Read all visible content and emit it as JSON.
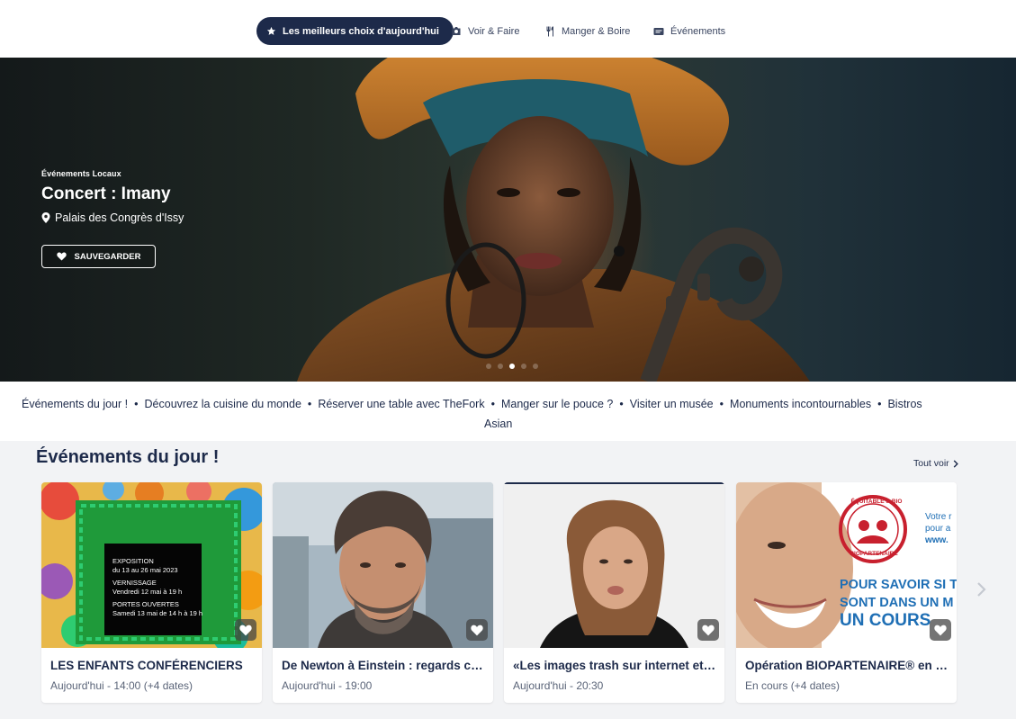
{
  "nav": {
    "tabs": [
      {
        "label": "Les meilleurs choix d'aujourd'hui",
        "icon": "star-icon",
        "active": true
      },
      {
        "label": "Voir & Faire",
        "icon": "camera-icon",
        "active": false
      },
      {
        "label": "Manger & Boire",
        "icon": "cutlery-icon",
        "active": false
      },
      {
        "label": "Événements",
        "icon": "ticket-icon",
        "active": false
      }
    ]
  },
  "hero": {
    "category": "Événements Locaux",
    "title": "Concert : Imany",
    "location": "Palais des Congrès d'Issy",
    "save_label": "SAUVEGARDER",
    "slide_count": 5,
    "active_slide": 2
  },
  "quick_links": {
    "items": [
      "Événements du jour !",
      "Découvrez la cuisine du monde",
      "Réserver une table avec TheFork",
      "Manger sur le pouce ?",
      "Visiter un musée",
      "Monuments incontournables",
      "Bistros"
    ],
    "overflow": "Asian"
  },
  "section": {
    "title": "Événements du jour !",
    "see_all": "Tout voir",
    "cards": [
      {
        "title": "LES ENFANTS CONFÉRENCIERS",
        "date": "Aujourd'hui - 14:00 (+4 dates)",
        "poster": {
          "l1": "EXPOSITION",
          "l2": "du 13 au 26 mai 2023",
          "l3": "VERNISSAGE",
          "l4": "Vendredi 12 mai à 19 h",
          "l5": "PORTES OUVERTES",
          "l6": "Samedi 13 mai de 14 h à 19 h"
        }
      },
      {
        "title": "De Newton à Einstein : regards croisés",
        "date": "Aujourd'hui - 19:00"
      },
      {
        "title": "«Les images trash sur internet et les jeunes»",
        "date": "Aujourd'hui - 20:30"
      },
      {
        "title": "Opération BIOPARTENAIRE® en magasin",
        "date": "En cours (+4 dates)",
        "poster": {
          "seal_top": "ÉQUITABLE & BIO",
          "seal_bottom": "BIOPARTENAIRE",
          "l1": "Votre r",
          "l2": "pour a",
          "l3": "www.",
          "l4": "POUR SAVOIR SI T",
          "l5": "SONT DANS UN M",
          "l6": "UN COURS"
        }
      }
    ]
  },
  "colors": {
    "navy": "#1d2a4a",
    "background": "#f2f3f5",
    "accent_red": "#c8202e",
    "green_frame": "#1f9a3a"
  }
}
